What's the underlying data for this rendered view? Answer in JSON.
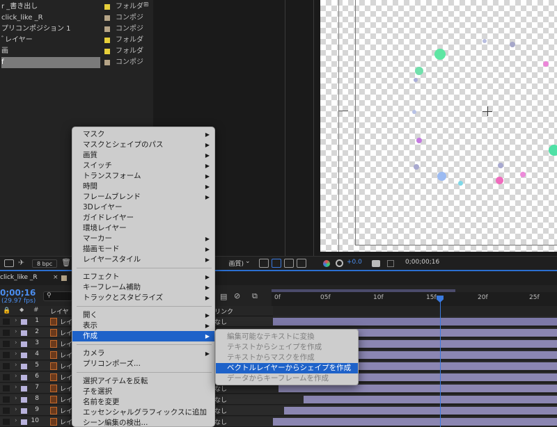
{
  "project": {
    "items": [
      {
        "name": "r _書き出し",
        "type": "フォルダー",
        "color": "#e6cf3a",
        "selected": false
      },
      {
        "name": "click_like _R",
        "type": "コンポジシ",
        "color": "#b5a487",
        "selected": false
      },
      {
        "name": "プリコンポジション 1",
        "type": "コンポジシ",
        "color": "#b5a487",
        "selected": false
      },
      {
        "name": "ﾞレイヤー",
        "type": "フォルダー",
        "color": "#e6cf3a",
        "selected": false
      },
      {
        "name": "画",
        "type": "フォルダー",
        "color": "#e6cf3a",
        "selected": false
      },
      {
        "name": "f",
        "type": "コンポジシ",
        "color": "#b5a487",
        "selected": true
      }
    ]
  },
  "left_toolbar": {
    "bpc": "8 bpc"
  },
  "viewer_toolbar": {
    "quality": "画質)",
    "exposure": "+0.0",
    "timecode": "0;00;00;16"
  },
  "timeline": {
    "tab_title": "click_like _R",
    "close_glyph": "×",
    "current_time": "0;00;16",
    "fps": "(29.97 fps)",
    "search_icon": "search-icon",
    "col_layer_header": "レイヤ",
    "col_parent_header": "リンク",
    "ruler_ticks": [
      "0f",
      "05f",
      "10f",
      "15f",
      "20f",
      "25f"
    ],
    "rows": [
      {
        "num": "1",
        "name": "レイ",
        "parent": "なし"
      },
      {
        "num": "2",
        "name": "レイ",
        "parent": ""
      },
      {
        "num": "3",
        "name": "レイ",
        "parent": ""
      },
      {
        "num": "4",
        "name": "レイ",
        "parent": ""
      },
      {
        "num": "5",
        "name": "レイ",
        "parent": ""
      },
      {
        "num": "6",
        "name": "レイ",
        "parent": ""
      },
      {
        "num": "7",
        "name": "レイ",
        "parent": "なし"
      },
      {
        "num": "8",
        "name": "レイ",
        "parent": "なし"
      },
      {
        "num": "9",
        "name": "レイ",
        "parent": "なし"
      },
      {
        "num": "10",
        "name": "レイ",
        "parent": "なし"
      }
    ]
  },
  "context_menu": {
    "items": [
      {
        "label": "マスク",
        "submenu": true
      },
      {
        "label": "マスクとシェイプのパス",
        "submenu": true
      },
      {
        "label": "画質",
        "submenu": true
      },
      {
        "label": "スイッチ",
        "submenu": true
      },
      {
        "label": "トランスフォーム",
        "submenu": true
      },
      {
        "label": "時間",
        "submenu": true
      },
      {
        "label": "フレームブレンド",
        "submenu": true
      },
      {
        "label": "3Dレイヤー",
        "submenu": false
      },
      {
        "label": "ガイドレイヤー",
        "submenu": false
      },
      {
        "label": "環境レイヤー",
        "submenu": false
      },
      {
        "label": "マーカー",
        "submenu": true
      },
      {
        "label": "描画モード",
        "submenu": true
      },
      {
        "label": "レイヤースタイル",
        "submenu": true
      },
      {
        "label": "エフェクト",
        "submenu": true
      },
      {
        "label": "キーフレーム補助",
        "submenu": true
      },
      {
        "label": "トラックとスタビライズ",
        "submenu": true
      },
      {
        "label": "開く",
        "submenu": true
      },
      {
        "label": "表示",
        "submenu": true
      },
      {
        "label": "作成",
        "submenu": true,
        "highlighted": true
      },
      {
        "label": "カメラ",
        "submenu": true
      },
      {
        "label": "プリコンポーズ...",
        "submenu": false
      },
      {
        "label": "選択アイテムを反転",
        "submenu": false
      },
      {
        "label": "子を選択",
        "submenu": false
      },
      {
        "label": "名前を変更",
        "submenu": false
      },
      {
        "label": "エッセンシャルグラフィックスに追加",
        "submenu": false
      },
      {
        "label": "シーン編集の検出...",
        "submenu": false
      }
    ],
    "submenu_arrow": "▶"
  },
  "create_submenu": {
    "items": [
      {
        "label": "編集可能なテキストに変換",
        "enabled": false
      },
      {
        "label": "テキストからシェイプを作成",
        "enabled": false
      },
      {
        "label": "テキストからマスクを作成",
        "enabled": false
      },
      {
        "label": "ベクトルレイヤーからシェイプを作成",
        "enabled": true,
        "highlighted": true
      },
      {
        "label": "データからキーフレームを作成",
        "enabled": false
      }
    ]
  },
  "colors": {
    "accent_blue": "#1e62c9",
    "label_lavender": "#b9b3dd",
    "folder_yellow": "#e6cf3a",
    "comp_tan": "#b5a487"
  }
}
